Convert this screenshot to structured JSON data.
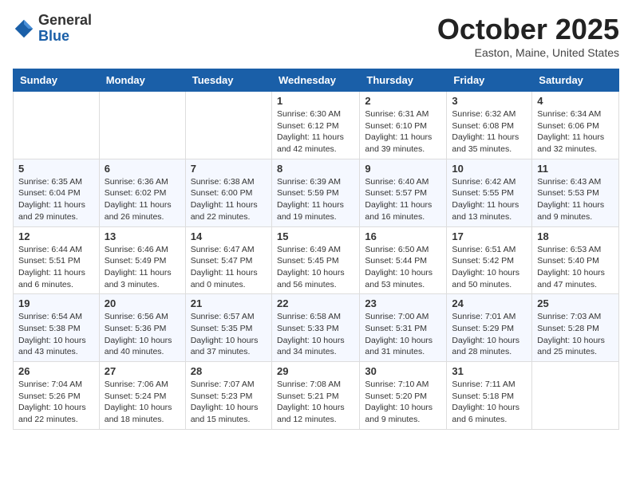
{
  "logo": {
    "general": "General",
    "blue": "Blue"
  },
  "title": "October 2025",
  "location": "Easton, Maine, United States",
  "weekdays": [
    "Sunday",
    "Monday",
    "Tuesday",
    "Wednesday",
    "Thursday",
    "Friday",
    "Saturday"
  ],
  "weeks": [
    [
      {
        "day": "",
        "info": ""
      },
      {
        "day": "",
        "info": ""
      },
      {
        "day": "",
        "info": ""
      },
      {
        "day": "1",
        "info": "Sunrise: 6:30 AM\nSunset: 6:12 PM\nDaylight: 11 hours\nand 42 minutes."
      },
      {
        "day": "2",
        "info": "Sunrise: 6:31 AM\nSunset: 6:10 PM\nDaylight: 11 hours\nand 39 minutes."
      },
      {
        "day": "3",
        "info": "Sunrise: 6:32 AM\nSunset: 6:08 PM\nDaylight: 11 hours\nand 35 minutes."
      },
      {
        "day": "4",
        "info": "Sunrise: 6:34 AM\nSunset: 6:06 PM\nDaylight: 11 hours\nand 32 minutes."
      }
    ],
    [
      {
        "day": "5",
        "info": "Sunrise: 6:35 AM\nSunset: 6:04 PM\nDaylight: 11 hours\nand 29 minutes."
      },
      {
        "day": "6",
        "info": "Sunrise: 6:36 AM\nSunset: 6:02 PM\nDaylight: 11 hours\nand 26 minutes."
      },
      {
        "day": "7",
        "info": "Sunrise: 6:38 AM\nSunset: 6:00 PM\nDaylight: 11 hours\nand 22 minutes."
      },
      {
        "day": "8",
        "info": "Sunrise: 6:39 AM\nSunset: 5:59 PM\nDaylight: 11 hours\nand 19 minutes."
      },
      {
        "day": "9",
        "info": "Sunrise: 6:40 AM\nSunset: 5:57 PM\nDaylight: 11 hours\nand 16 minutes."
      },
      {
        "day": "10",
        "info": "Sunrise: 6:42 AM\nSunset: 5:55 PM\nDaylight: 11 hours\nand 13 minutes."
      },
      {
        "day": "11",
        "info": "Sunrise: 6:43 AM\nSunset: 5:53 PM\nDaylight: 11 hours\nand 9 minutes."
      }
    ],
    [
      {
        "day": "12",
        "info": "Sunrise: 6:44 AM\nSunset: 5:51 PM\nDaylight: 11 hours\nand 6 minutes."
      },
      {
        "day": "13",
        "info": "Sunrise: 6:46 AM\nSunset: 5:49 PM\nDaylight: 11 hours\nand 3 minutes."
      },
      {
        "day": "14",
        "info": "Sunrise: 6:47 AM\nSunset: 5:47 PM\nDaylight: 11 hours\nand 0 minutes."
      },
      {
        "day": "15",
        "info": "Sunrise: 6:49 AM\nSunset: 5:45 PM\nDaylight: 10 hours\nand 56 minutes."
      },
      {
        "day": "16",
        "info": "Sunrise: 6:50 AM\nSunset: 5:44 PM\nDaylight: 10 hours\nand 53 minutes."
      },
      {
        "day": "17",
        "info": "Sunrise: 6:51 AM\nSunset: 5:42 PM\nDaylight: 10 hours\nand 50 minutes."
      },
      {
        "day": "18",
        "info": "Sunrise: 6:53 AM\nSunset: 5:40 PM\nDaylight: 10 hours\nand 47 minutes."
      }
    ],
    [
      {
        "day": "19",
        "info": "Sunrise: 6:54 AM\nSunset: 5:38 PM\nDaylight: 10 hours\nand 43 minutes."
      },
      {
        "day": "20",
        "info": "Sunrise: 6:56 AM\nSunset: 5:36 PM\nDaylight: 10 hours\nand 40 minutes."
      },
      {
        "day": "21",
        "info": "Sunrise: 6:57 AM\nSunset: 5:35 PM\nDaylight: 10 hours\nand 37 minutes."
      },
      {
        "day": "22",
        "info": "Sunrise: 6:58 AM\nSunset: 5:33 PM\nDaylight: 10 hours\nand 34 minutes."
      },
      {
        "day": "23",
        "info": "Sunrise: 7:00 AM\nSunset: 5:31 PM\nDaylight: 10 hours\nand 31 minutes."
      },
      {
        "day": "24",
        "info": "Sunrise: 7:01 AM\nSunset: 5:29 PM\nDaylight: 10 hours\nand 28 minutes."
      },
      {
        "day": "25",
        "info": "Sunrise: 7:03 AM\nSunset: 5:28 PM\nDaylight: 10 hours\nand 25 minutes."
      }
    ],
    [
      {
        "day": "26",
        "info": "Sunrise: 7:04 AM\nSunset: 5:26 PM\nDaylight: 10 hours\nand 22 minutes."
      },
      {
        "day": "27",
        "info": "Sunrise: 7:06 AM\nSunset: 5:24 PM\nDaylight: 10 hours\nand 18 minutes."
      },
      {
        "day": "28",
        "info": "Sunrise: 7:07 AM\nSunset: 5:23 PM\nDaylight: 10 hours\nand 15 minutes."
      },
      {
        "day": "29",
        "info": "Sunrise: 7:08 AM\nSunset: 5:21 PM\nDaylight: 10 hours\nand 12 minutes."
      },
      {
        "day": "30",
        "info": "Sunrise: 7:10 AM\nSunset: 5:20 PM\nDaylight: 10 hours\nand 9 minutes."
      },
      {
        "day": "31",
        "info": "Sunrise: 7:11 AM\nSunset: 5:18 PM\nDaylight: 10 hours\nand 6 minutes."
      },
      {
        "day": "",
        "info": ""
      }
    ]
  ]
}
